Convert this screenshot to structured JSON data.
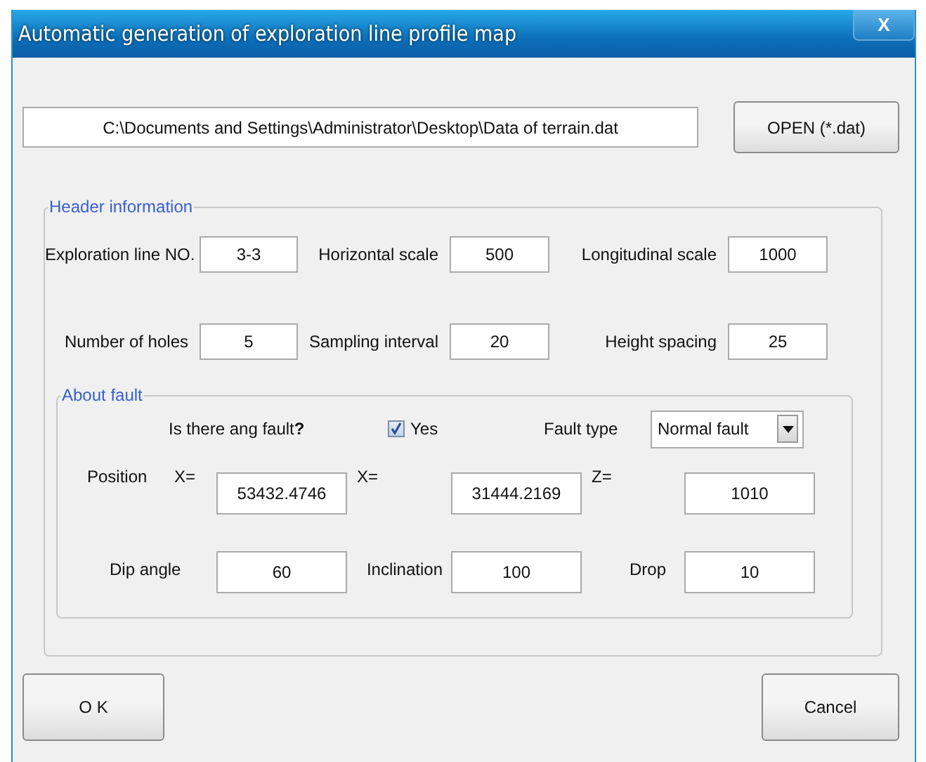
{
  "window": {
    "title": "Automatic generation of exploration line profile map",
    "close_label": "X"
  },
  "file_path": {
    "value": "C:\\Documents and Settings\\Administrator\\Desktop\\Data of terrain.dat"
  },
  "open_button": "OPEN (*.dat)",
  "header_information": {
    "legend": "Header information",
    "fields": [
      {
        "label": "Exploration line NO.",
        "value": "3-3"
      },
      {
        "label": "Horizontal scale",
        "value": "500"
      },
      {
        "label": "Longitudinal scale",
        "value": "1000"
      },
      {
        "label": "Number of holes",
        "value": "5"
      },
      {
        "label": "Sampling interval",
        "value": "20"
      },
      {
        "label": "Height spacing",
        "value": "25"
      }
    ]
  },
  "about_fault": {
    "legend": "About fault",
    "question": "Is there ang fault**?**",
    "fault_checkbox": {
      "label": "Yes",
      "checked": true
    },
    "fault_type": {
      "label": "Fault type",
      "value": "Normal fault"
    },
    "position": {
      "label": "Position",
      "coordinates": [
        {
          "label": "X=",
          "value": "53432.4746"
        },
        {
          "label": "X=",
          "value": "31444.2169"
        },
        {
          "label": "Z=",
          "value": "1010"
        }
      ]
    },
    "fields": [
      {
        "label": "Dip angle",
        "value": "60"
      },
      {
        "label": "Inclination",
        "value": "100"
      },
      {
        "label": "Drop",
        "value": "10"
      }
    ]
  },
  "buttons": [
    "O K",
    "Cancel"
  ]
}
